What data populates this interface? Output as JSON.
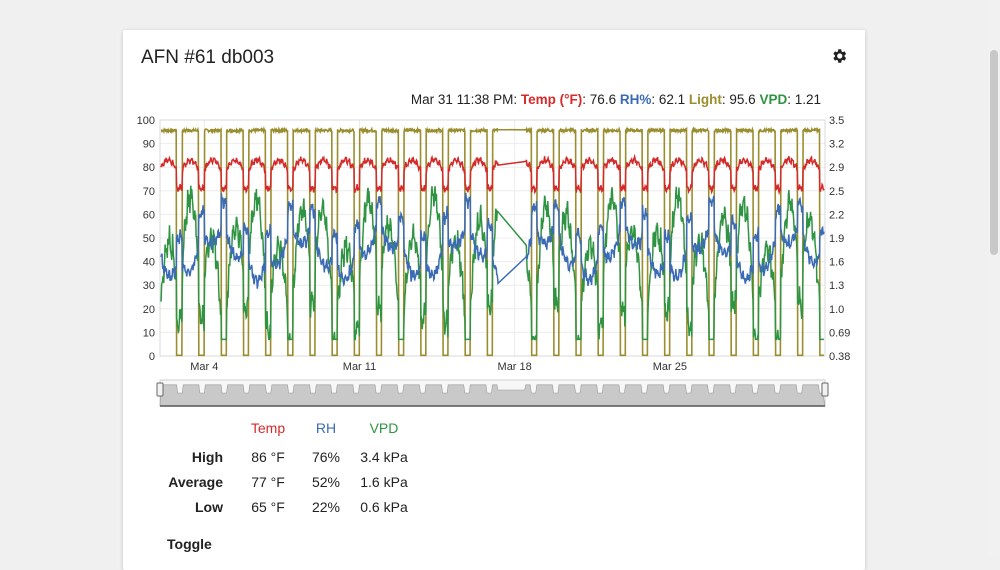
{
  "card": {
    "title": "AFN #61 db003"
  },
  "icons": {
    "settings": "gear-icon"
  },
  "readout": {
    "datetime": "Mar 31 11:38 PM:",
    "temp_label": "Temp (°F)",
    "temp_value": ": 76.6",
    "rh_label": "RH%",
    "rh_value": ": 62.1",
    "light_label": "Light",
    "light_value": ": 95.6",
    "vpd_label": "VPD",
    "vpd_value": ": 1.21"
  },
  "colors": {
    "temp": "#d42a2a",
    "rh": "#3b6bb5",
    "light": "#9a8d2e",
    "vpd": "#2f9442"
  },
  "chart_data": {
    "type": "line",
    "x_type": "date",
    "x_range": [
      "Mar 2",
      "Apr 1"
    ],
    "x_ticks": [
      "Mar 4",
      "Mar 11",
      "Mar 18",
      "Mar 25"
    ],
    "x_tick_days": [
      4,
      11,
      18,
      25
    ],
    "y_left": {
      "ticks": [
        "0",
        "10",
        "20",
        "30",
        "40",
        "50",
        "60",
        "70",
        "80",
        "90",
        "100"
      ],
      "range": [
        0,
        100
      ]
    },
    "y_right": {
      "ticks": [
        "0.38",
        "0.69",
        "1.0",
        "1.3",
        "1.6",
        "1.9",
        "2.2",
        "2.5",
        "2.9",
        "3.2",
        "3.5"
      ],
      "range": [
        0.38,
        3.5
      ]
    },
    "gap": [
      "Mar 17 06:00",
      "Mar 18 12:00"
    ],
    "grid": true,
    "series": [
      {
        "name": "Temp (°F)",
        "key": "temp",
        "axis": "left",
        "mean": 77,
        "min": 65,
        "max": 86
      },
      {
        "name": "RH%",
        "key": "rh",
        "axis": "left",
        "mean": 52,
        "min": 22,
        "max": 76
      },
      {
        "name": "Light",
        "key": "light",
        "axis": "left",
        "on": 95.6,
        "off": 0
      },
      {
        "name": "VPD",
        "key": "vpd",
        "axis": "right",
        "mean": 1.6,
        "min": 0.6,
        "max": 3.4
      }
    ]
  },
  "stats": {
    "headers": [
      "Temp",
      "RH",
      "VPD"
    ],
    "rows": [
      {
        "label": "High",
        "values": [
          "86 °F",
          "76%",
          "3.4 kPa"
        ]
      },
      {
        "label": "Average",
        "values": [
          "77 °F",
          "52%",
          "1.6 kPa"
        ]
      },
      {
        "label": "Low",
        "values": [
          "65 °F",
          "22%",
          "0.6 kPa"
        ]
      }
    ]
  },
  "toggle": {
    "label": "Toggle"
  }
}
